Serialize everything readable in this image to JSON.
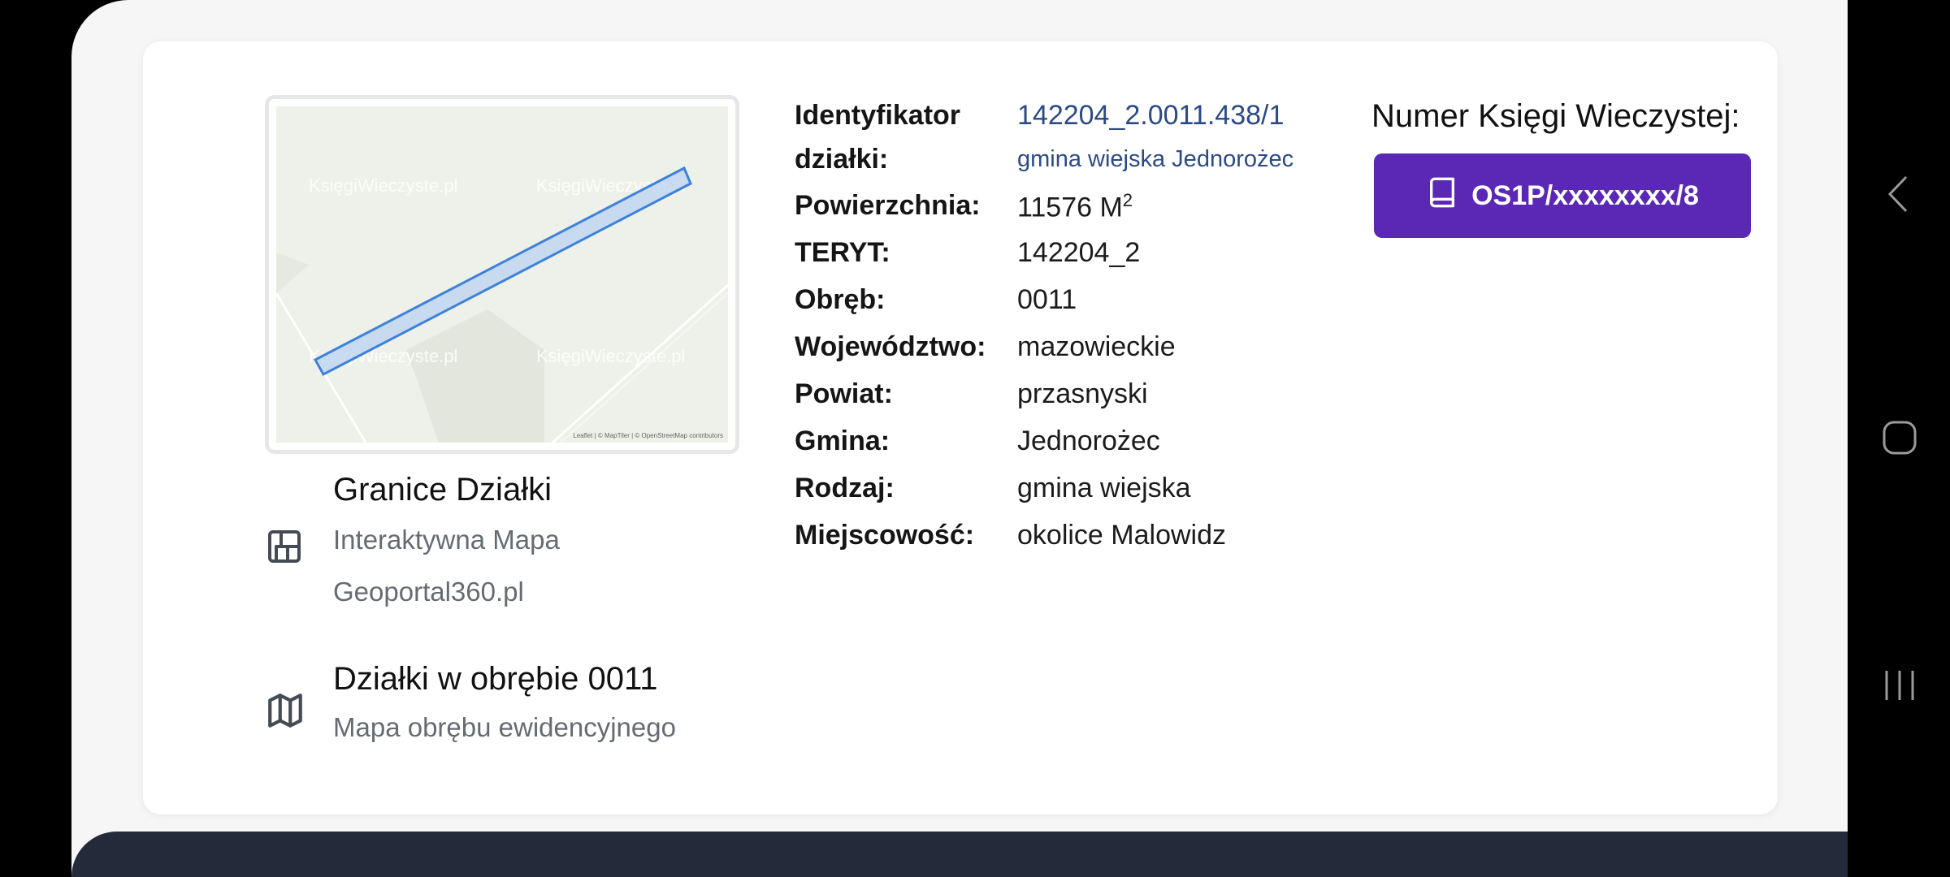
{
  "map": {
    "watermark_brand": "KsięgiWieczyste.pl",
    "attribution": "Leaflet | © MapTiler | © OpenStreetMap contributors"
  },
  "links": [
    {
      "icon": "layout-icon",
      "title": "Granice Działki",
      "subtitle_line1": "Interaktywna Mapa",
      "subtitle_line2": "Geoportal360.pl"
    },
    {
      "icon": "map-icon",
      "title": "Działki w obrębie 0011",
      "subtitle_line1": "Mapa obrębu ewidencyjnego"
    }
  ],
  "details": {
    "id_label_line1": "Identyfikator",
    "id_label_line2": "działki:",
    "id_value": "142204_2.0011.438/1",
    "id_sub_value": "gmina wiejska Jednorożec",
    "area_label": "Powierzchnia:",
    "area_value": "11576 M",
    "area_unit_sup": "2",
    "rows": [
      {
        "label": "TERYT:",
        "value": "142204_2"
      },
      {
        "label": "Obręb:",
        "value": "0011"
      },
      {
        "label": "Województwo:",
        "value": "mazowieckie"
      },
      {
        "label": "Powiat:",
        "value": "przasnyski"
      },
      {
        "label": "Gmina:",
        "value": "Jednorożec"
      },
      {
        "label": "Rodzaj:",
        "value": "gmina wiejska"
      },
      {
        "label": "Miejscowość:",
        "value": "okolice Malowidz"
      }
    ]
  },
  "kw": {
    "title": "Numer Księgi Wieczystej:",
    "button_label": "OS1P/xxxxxxxx/8",
    "button_icon": "book-icon",
    "button_color": "#5b27b5"
  },
  "android_nav": [
    "back-icon",
    "home-icon",
    "recents-icon"
  ]
}
